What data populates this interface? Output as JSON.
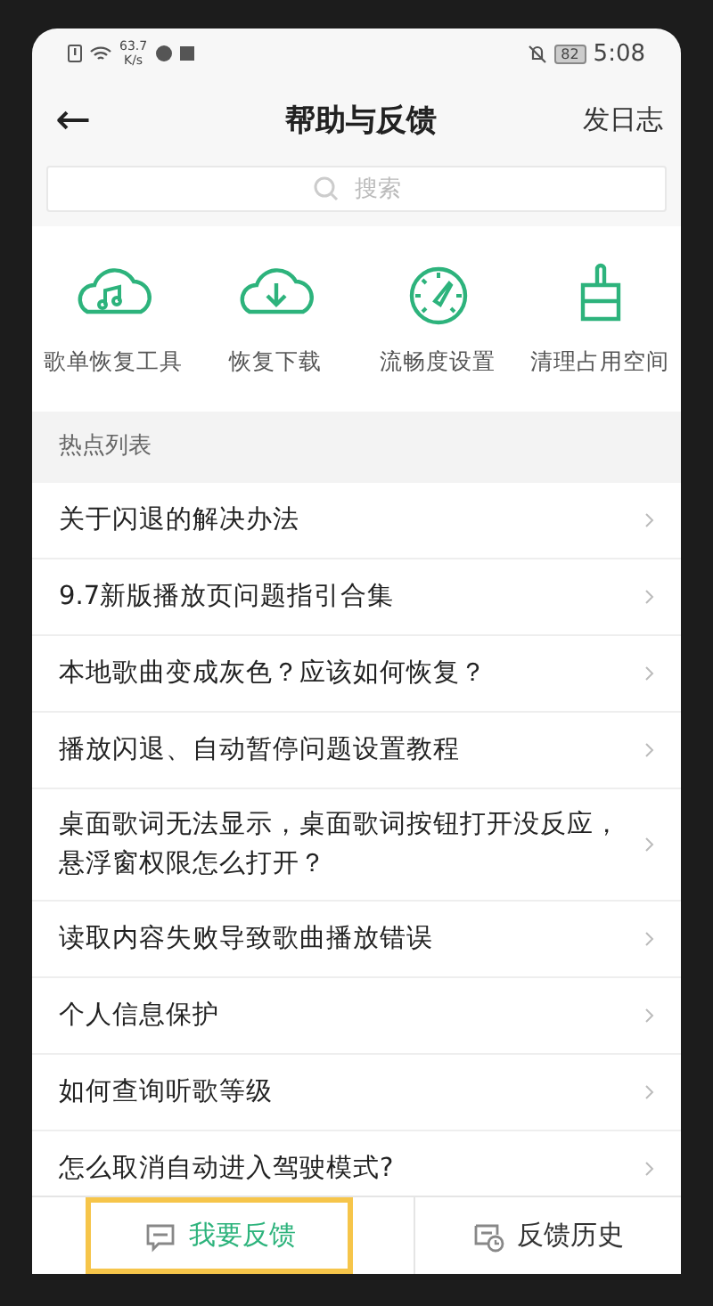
{
  "status_bar": {
    "speed_value": "63.7",
    "speed_unit": "K/s",
    "battery": "82",
    "time": "5:08"
  },
  "header": {
    "back": "←",
    "title": "帮助与反馈",
    "action": "发日志"
  },
  "search": {
    "placeholder": "搜索"
  },
  "tools": [
    {
      "kind": "music-cloud",
      "label": "歌单恢复工具"
    },
    {
      "kind": "download-cloud",
      "label": "恢复下载"
    },
    {
      "kind": "gauge",
      "label": "流畅度设置"
    },
    {
      "kind": "brush",
      "label": "清理占用空间"
    }
  ],
  "hot_list": {
    "title": "热点列表",
    "items": [
      {
        "text": "关于闪退的解决办法"
      },
      {
        "text": "9.7新版播放页问题指引合集"
      },
      {
        "text": "本地歌曲变成灰色？应该如何恢复？"
      },
      {
        "text": "播放闪退、自动暂停问题设置教程"
      },
      {
        "text": "桌面歌词无法显示，桌面歌词按钮打开没反应，悬浮窗权限怎么打开？"
      },
      {
        "text": "读取内容失败导致歌曲播放错误"
      },
      {
        "text": "个人信息保护"
      },
      {
        "text": "如何查询听歌等级"
      },
      {
        "text": "怎么取消自动进入驾驶模式?"
      }
    ]
  },
  "bottom_tabs": [
    {
      "kind": "feedback",
      "label": "我要反馈",
      "selected": true
    },
    {
      "kind": "history",
      "label": "反馈历史",
      "selected": false
    }
  ]
}
